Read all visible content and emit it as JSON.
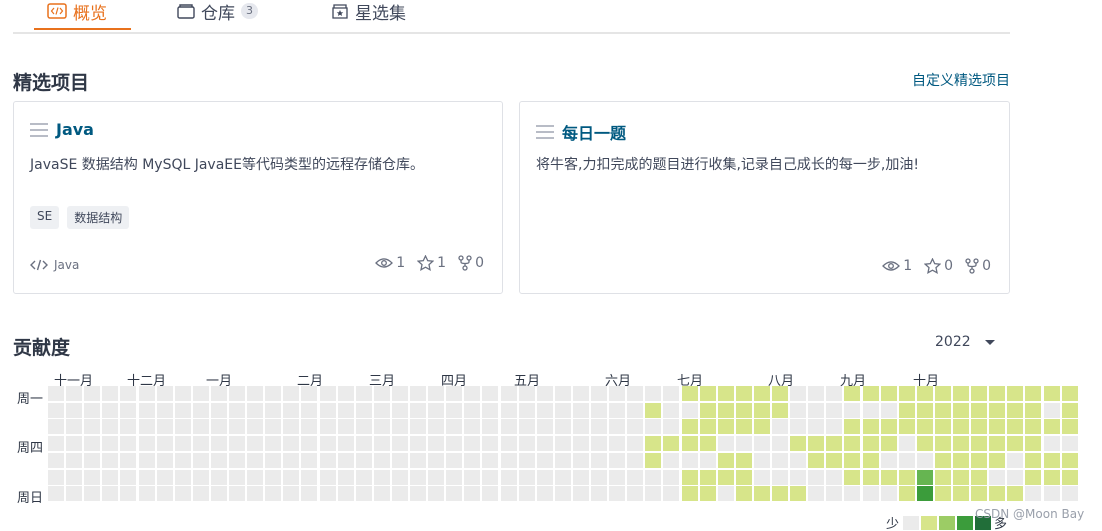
{
  "tabs": [
    {
      "label": "概览",
      "icon": "code-icon",
      "active": true
    },
    {
      "label": "仓库",
      "icon": "repo-icon",
      "count": "3"
    },
    {
      "label": "星选集",
      "icon": "star-box-icon"
    }
  ],
  "featured": {
    "title": "精选项目",
    "customize_label": "自定义精选项目",
    "projects": [
      {
        "name": "Java",
        "description": "JavaSE 数据结构 MySQL JavaEE等代码类型的远程存储仓库。",
        "tags": [
          "SE",
          "数据结构"
        ],
        "language": "Java",
        "watch": "1",
        "star": "1",
        "fork": "0"
      },
      {
        "name": "每日一题",
        "description": "将牛客,力扣完成的题目进行收集,记录自己成长的每一步,加油!",
        "tags": [],
        "language": "",
        "watch": "1",
        "star": "0",
        "fork": "0"
      }
    ]
  },
  "contribution": {
    "title": "贡献度",
    "year": "2022",
    "months": [
      "十一月",
      "十二月",
      "一月",
      "二月",
      "三月",
      "四月",
      "五月",
      "六月",
      "七月",
      "八月",
      "九月",
      "十月"
    ],
    "weekdays": [
      "周一",
      "周四",
      "周日"
    ],
    "legend_few": "少",
    "legend_many": "多",
    "colors": [
      "#ebebeb",
      "#d7e58a",
      "#9ccc65",
      "#66b551",
      "#3b9c3b",
      "#216e39"
    ],
    "level_rows": [
      "000000000000000000000000000000000001111110001111111111111",
      "000000000000000000000000000000000100111110000001111111101",
      "000000000000000000000000000000000001111100001111111111111",
      "000000000000000000000000000000000111100001111110111111100",
      "000000000000000000000000000000000100011000111100011110111",
      "000000000000000000000000000000000001111000001111311100111",
      "000000000000000000000000000000000001101111000001411111000"
    ]
  },
  "watermark": "CSDN @Moon Bay"
}
